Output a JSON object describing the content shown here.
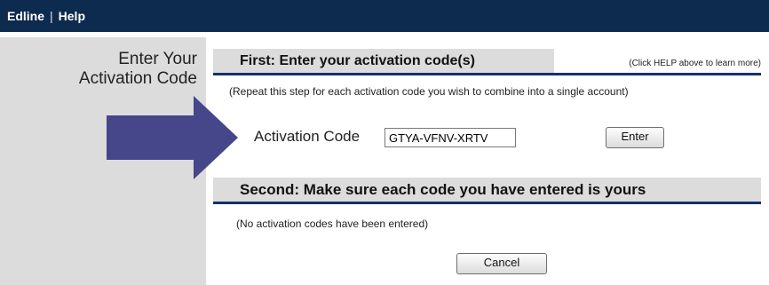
{
  "topbar": {
    "app_link": "Edline",
    "separator": "|",
    "help_link": "Help"
  },
  "sidebar": {
    "title_line1": "Enter Your",
    "title_line2": "Activation Code"
  },
  "step1": {
    "heading": "First: Enter your activation code(s)",
    "help_note": "(Click HELP above to learn more)",
    "repeat_note": "(Repeat this step for each activation code you wish to combine into a single account)",
    "code_label": "Activation Code",
    "code_value": "GTYA-VFNV-XRTV",
    "enter_button": "Enter"
  },
  "step2": {
    "heading": "Second: Make sure each code you have entered is yours",
    "empty_note": "(No activation codes have been entered)",
    "cancel_button": "Cancel"
  },
  "colors": {
    "header_bg": "#0d2b4e",
    "rule": "#15306c",
    "arrow": "#46468a",
    "panel": "#dcdcdc"
  },
  "icons": {
    "arrow": "right-arrow-icon"
  }
}
